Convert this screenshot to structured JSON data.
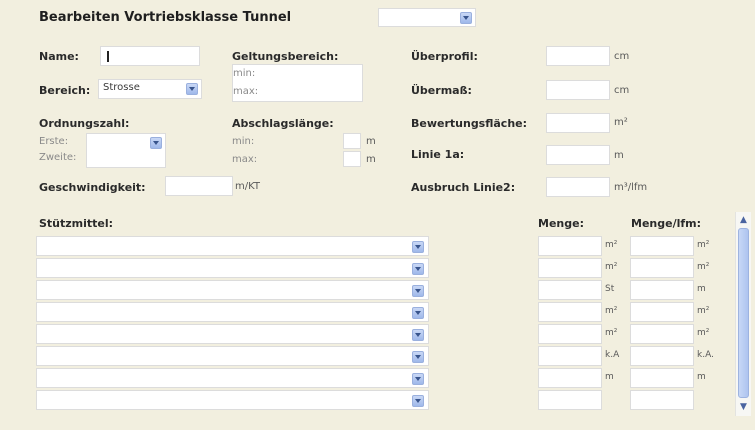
{
  "header": {
    "title": "Bearbeiten Vortriebsklasse Tunnel",
    "selector_value": ""
  },
  "left": {
    "name_label": "Name:",
    "bereich_label": "Bereich:",
    "bereich_value": "Strosse",
    "ordnungszahl_label": "Ordnungszahl:",
    "erste_label": "Erste:",
    "zweite_label": "Zweite:",
    "geschwindigkeit_label": "Geschwindigkeit:",
    "geschwindigkeit_unit": "m/KT"
  },
  "middle": {
    "geltungsbereich_label": "Geltungsbereich:",
    "min_label": "min:",
    "max_label": "max:",
    "abschlag_label": "Abschlagslänge:",
    "abschlag_min_label": "min:",
    "abschlag_max_label": "max:",
    "abschlag_min_unit": "m",
    "abschlag_max_unit": "m"
  },
  "right": {
    "ueberprofil_label": "Überprofil:",
    "ueberprofil_unit": "cm",
    "uebermass_label": "Übermaß:",
    "uebermass_unit": "cm",
    "bewertung_label": "Bewertungsfläche:",
    "bewertung_unit": "m²",
    "linie1a_label": "Linie 1a:",
    "linie1a_unit": "m",
    "ausbruch_label": "Ausbruch Linie2:",
    "ausbruch_unit": "m³/lfm"
  },
  "stuetzmittel": {
    "label": "Stützmittel:",
    "menge_label": "Menge:",
    "menge_lfm_label": "Menge/lfm:",
    "rows": [
      {
        "unit": "m²",
        "unit_lfm": "m²"
      },
      {
        "unit": "m²",
        "unit_lfm": "m²"
      },
      {
        "unit": "St",
        "unit_lfm": "m"
      },
      {
        "unit": "m²",
        "unit_lfm": "m²"
      },
      {
        "unit": "m²",
        "unit_lfm": "m²"
      },
      {
        "unit": "k.A",
        "unit_lfm": "k.A."
      },
      {
        "unit": "m",
        "unit_lfm": "m"
      },
      {
        "unit": "",
        "unit_lfm": ""
      }
    ]
  },
  "scrollbar": {
    "up": "▲",
    "down": "▼"
  }
}
